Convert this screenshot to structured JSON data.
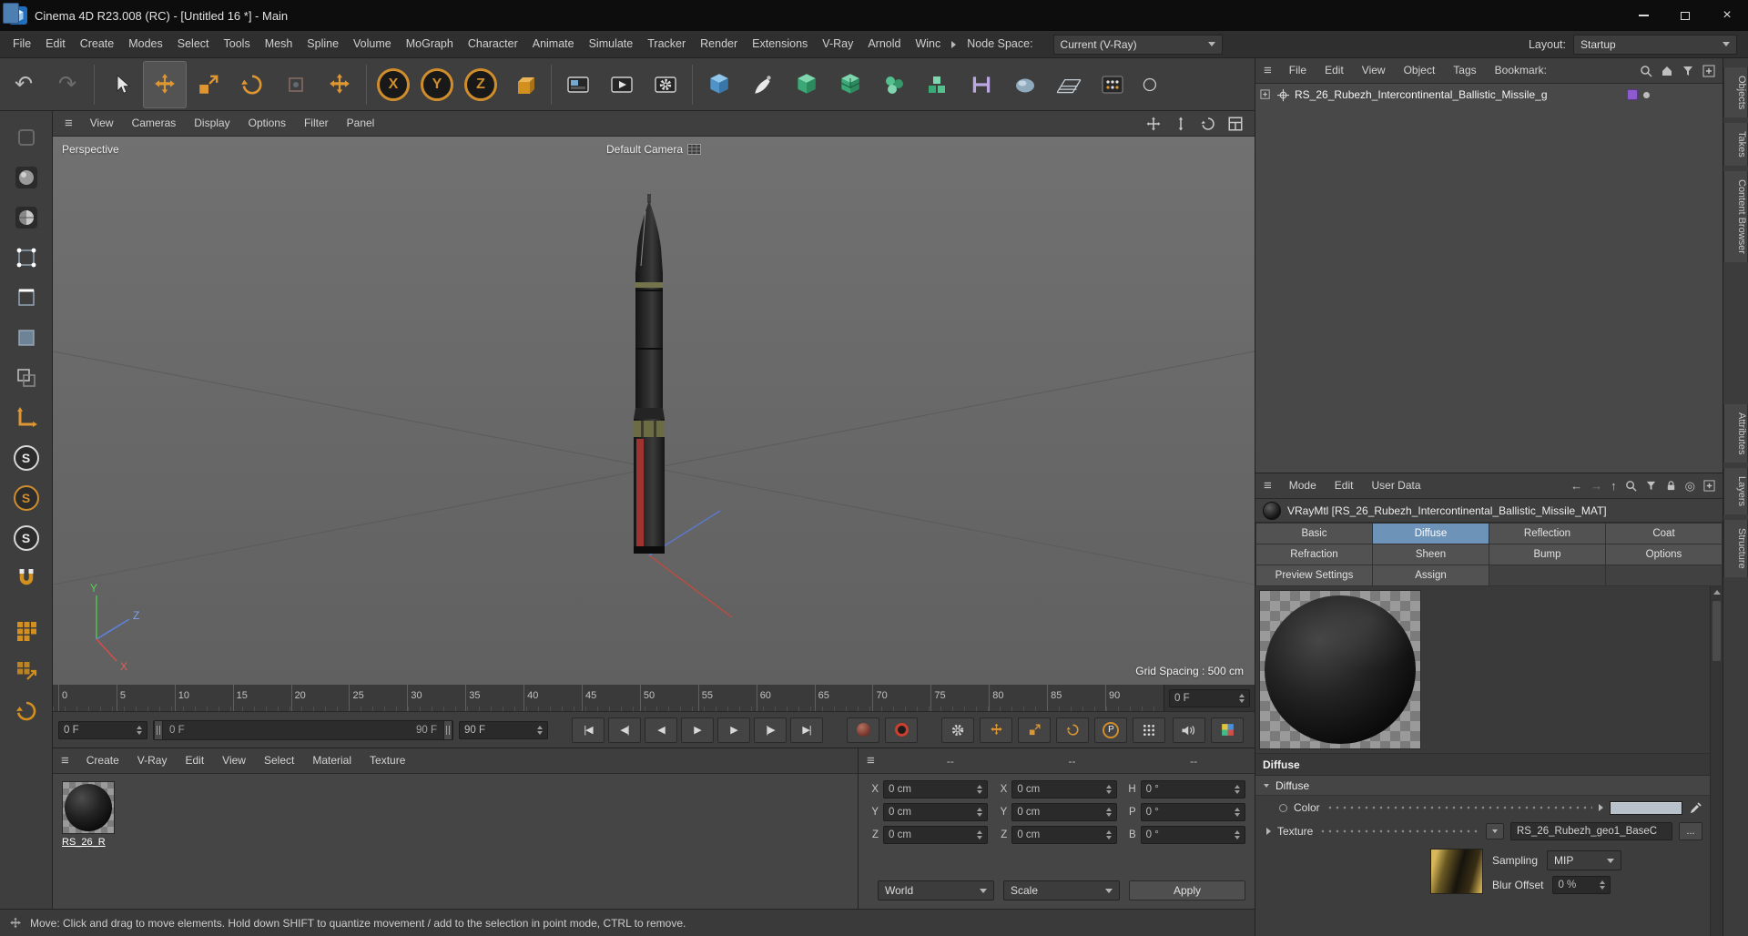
{
  "titlebar": {
    "title": "Cinema 4D R23.008 (RC) - [Untitled 16 *] - Main"
  },
  "menubar": {
    "items": [
      "File",
      "Edit",
      "Create",
      "Modes",
      "Select",
      "Tools",
      "Mesh",
      "Spline",
      "Volume",
      "MoGraph",
      "Character",
      "Animate",
      "Simulate",
      "Tracker",
      "Render",
      "Extensions",
      "V-Ray",
      "Arnold",
      "Winc"
    ],
    "node_space_label": "Node Space:",
    "node_space_value": "Current (V-Ray)",
    "layout_label": "Layout:",
    "layout_value": "Startup"
  },
  "icons": {
    "hamburger": "≡",
    "undo": "↶",
    "redo": "↷",
    "close": "×",
    "snap": "S",
    "p": "P",
    "arrow_left": "←",
    "arrow_right": "→",
    "arrow_up": "↑",
    "target": "◎"
  },
  "toolbar": {
    "axis_locks": [
      "X",
      "Y",
      "Z"
    ]
  },
  "viewport": {
    "menus": [
      "View",
      "Cameras",
      "Display",
      "Options",
      "Filter",
      "Panel"
    ],
    "view_label": "Perspective",
    "camera_label": "Default Camera",
    "grid_spacing_label": "Grid Spacing : 500 cm",
    "axis_labels": {
      "x": "X",
      "y": "Y",
      "z": "Z"
    }
  },
  "timeline": {
    "ticks": [
      "0",
      "5",
      "10",
      "15",
      "20",
      "25",
      "30",
      "35",
      "40",
      "45",
      "50",
      "55",
      "60",
      "65",
      "70",
      "75",
      "80",
      "85",
      "90"
    ],
    "current_frame": "0 F",
    "range_start": "0 F",
    "range_end": "90 F",
    "end_frame": "90 F",
    "transport": [
      "|◀",
      "◀|",
      "◀",
      "▶",
      "▶",
      "|▶",
      "▶|"
    ]
  },
  "materials_panel": {
    "menus": [
      "Create",
      "V-Ray",
      "Edit",
      "View",
      "Select",
      "Material",
      "Texture"
    ],
    "material_name": "RS_26_R"
  },
  "coords_panel": {
    "headers": [
      "--",
      "--",
      "--"
    ],
    "rows": [
      {
        "l1": "X",
        "v1": "0 cm",
        "l2": "X",
        "v2": "0 cm",
        "l3": "H",
        "v3": "0 °"
      },
      {
        "l1": "Y",
        "v1": "0 cm",
        "l2": "Y",
        "v2": "0 cm",
        "l3": "P",
        "v3": "0 °"
      },
      {
        "l1": "Z",
        "v1": "0 cm",
        "l2": "Z",
        "v2": "0 cm",
        "l3": "B",
        "v3": "0 °"
      }
    ],
    "transform_value": "World",
    "scale_value": "Scale",
    "apply_label": "Apply"
  },
  "objects_panel": {
    "menus": [
      "File",
      "Edit",
      "View",
      "Object",
      "Tags",
      "Bookmark:"
    ],
    "object_name": "RS_26_Rubezh_Intercontinental_Ballistic_Missile_g"
  },
  "attributes_panel": {
    "menus": [
      "Mode",
      "Edit",
      "User Data"
    ],
    "material_title": "VRayMtl [RS_26_Rubezh_Intercontinental_Ballistic_Missile_MAT]",
    "tabs": [
      "Basic",
      "Diffuse",
      "Reflection",
      "Coat",
      "Refraction",
      "Sheen",
      "Bump",
      "Options",
      "Preview Settings",
      "Assign"
    ],
    "section_title": "Diffuse",
    "subsection_title": "Diffuse",
    "color_label": "Color",
    "texture_label": "Texture",
    "texture_value": "RS_26_Rubezh_geo1_BaseC",
    "texture_more_label": "...",
    "sampling_label": "Sampling",
    "sampling_value": "MIP",
    "blur_label": "Blur Offset",
    "blur_value": "0 %"
  },
  "right_tabs": {
    "top": [
      "Objects",
      "Takes",
      "Content Browser"
    ],
    "bottom": [
      "Attributes",
      "Layers",
      "Structure"
    ]
  },
  "statusbar": {
    "text": "Move: Click and drag to move elements. Hold down SHIFT to quantize movement / add to the selection in point mode, CTRL to remove."
  }
}
